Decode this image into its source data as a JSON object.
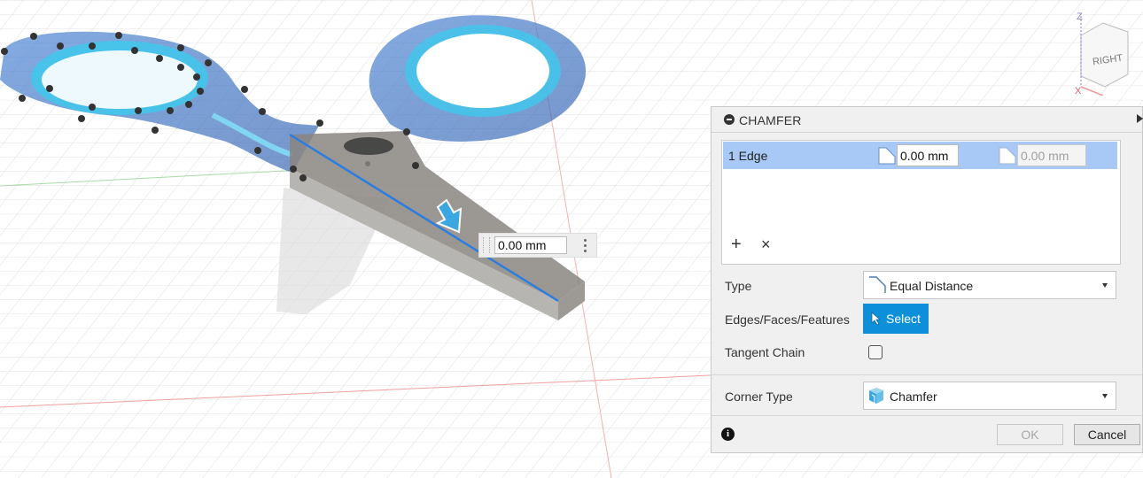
{
  "viewport": {
    "dimension_input_value": "0.00 mm"
  },
  "viewcube": {
    "face_label": "RIGHT",
    "z_axis_label": "Z",
    "x_axis_label": "X"
  },
  "panel": {
    "title": "CHAMFER",
    "selection_list": {
      "rows": [
        {
          "label": "1 Edge",
          "distance1": "0.00 mm",
          "distance2": "0.00 mm"
        }
      ],
      "add_symbol": "+",
      "remove_symbol": "×"
    },
    "type": {
      "label": "Type",
      "value": "Equal Distance"
    },
    "edges": {
      "label": "Edges/Faces/Features",
      "button_label": "Select"
    },
    "tangent_chain": {
      "label": "Tangent Chain",
      "checked": false
    },
    "corner_type": {
      "label": "Corner Type",
      "value": "Chamfer"
    },
    "info_symbol": "i",
    "ok_label": "OK",
    "cancel_label": "Cancel"
  },
  "colors": {
    "accent": "#0d8fd9",
    "selected_row": "#a8c8f5",
    "handle_fill": "#5bb8e8",
    "model_highlight": "#2a7de1"
  },
  "icons": [
    "chamfer-distance-icon",
    "equal-distance-icon",
    "cursor-arrow-icon",
    "chamfer-corner-icon",
    "info-icon",
    "minus-circle-icon",
    "collapse-arrow-icon"
  ]
}
